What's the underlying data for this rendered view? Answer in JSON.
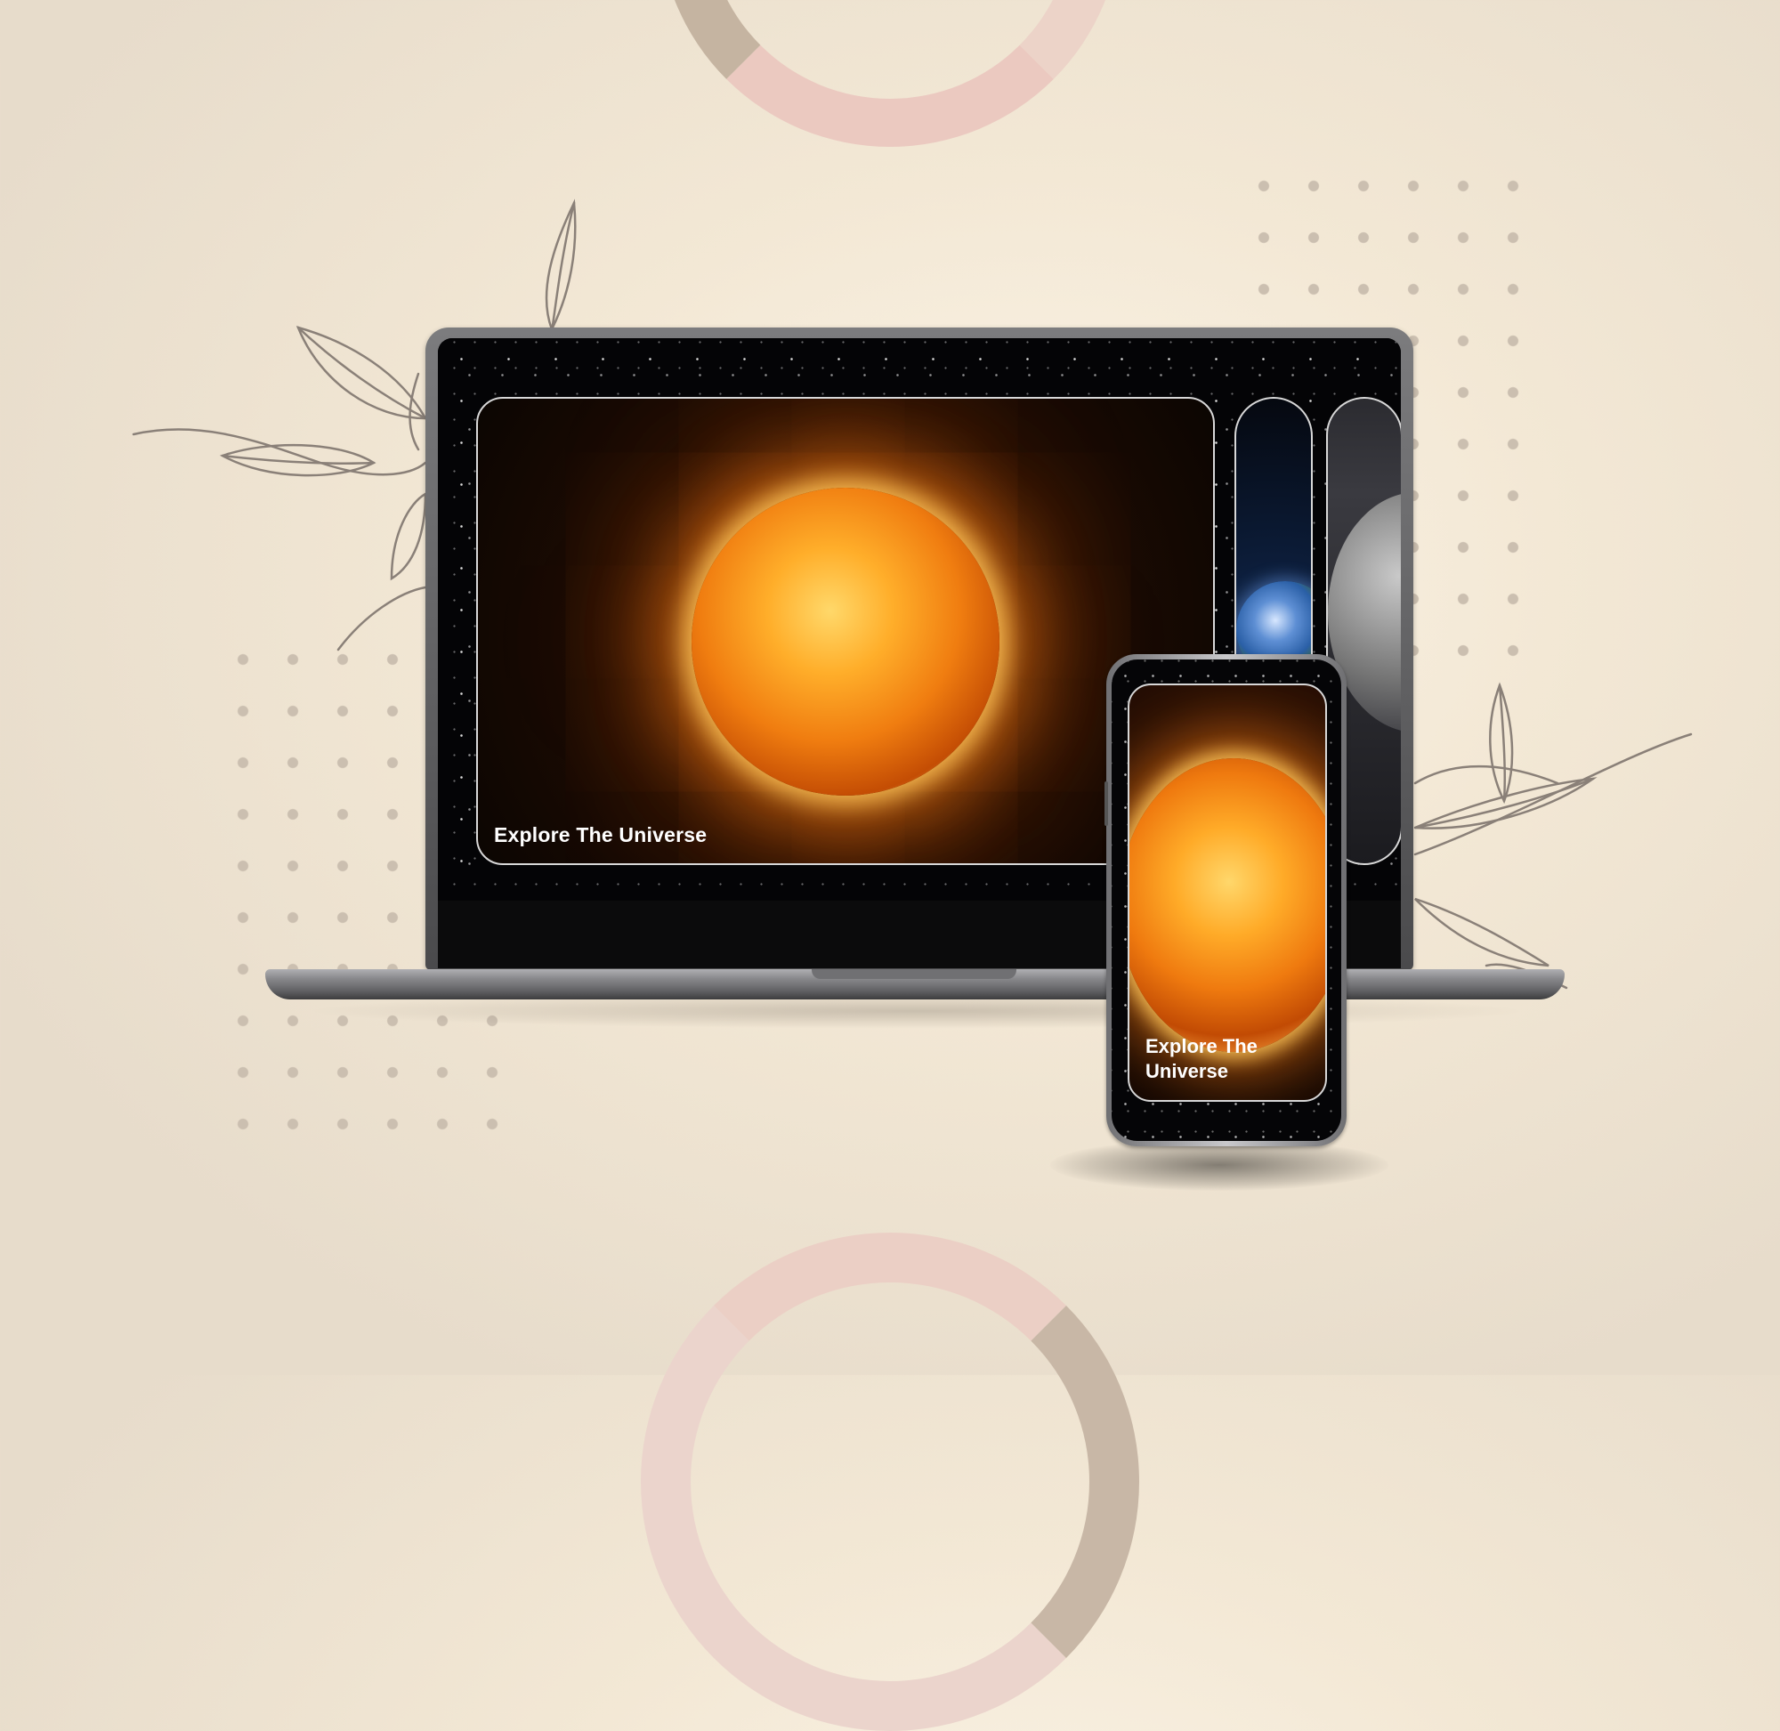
{
  "laptop": {
    "cards": [
      {
        "label": "Explore The Universe"
      },
      {
        "label": ""
      },
      {
        "label": ""
      }
    ]
  },
  "phone": {
    "card": {
      "label": "Explore The Universe"
    }
  },
  "colors": {
    "background": "#f3e8d5",
    "ring_accent": "#ecd3c8",
    "ring_secondary": "#c5b4a1",
    "dots": "#cbbfb0",
    "leaf_stroke": "#8a8078",
    "card_border": "#d8d8d8",
    "sun_core": "#ffd86a",
    "sun_edge": "#f07d10"
  }
}
